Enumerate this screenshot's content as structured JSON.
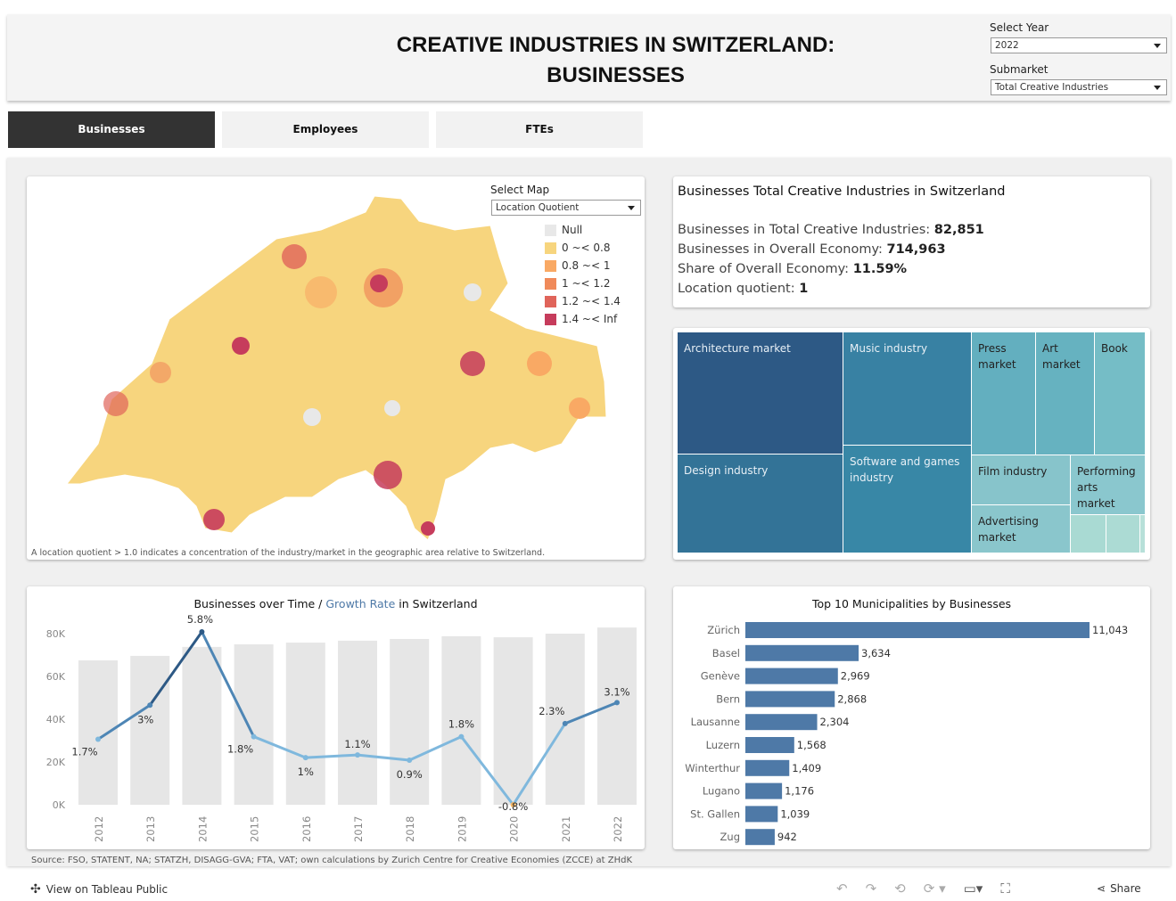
{
  "header": {
    "title_line1": "CREATIVE INDUSTRIES IN SWITZERLAND:",
    "title_line2": "BUSINESSES",
    "year_label": "Select Year",
    "year_value": "2022",
    "submarket_label": "Submarket",
    "submarket_value": "Total Creative Industries"
  },
  "tabs": [
    {
      "label": "Businesses",
      "active": true
    },
    {
      "label": "Employees"
    },
    {
      "label": "FTEs"
    }
  ],
  "map": {
    "select_label": "Select Map",
    "select_value": "Location Quotient",
    "note": "A location quotient > 1.0 indicates a concentration of the industry/market in the geographic area relative to Switzerland.",
    "legend": [
      {
        "label": "Null",
        "color": "#e8e8e8"
      },
      {
        "label": "0 ~< 0.8",
        "color": "#f7d57e"
      },
      {
        "label": "0.8 ~< 1",
        "color": "#f9a964"
      },
      {
        "label": "1 ~< 1.2",
        "color": "#f08a5a"
      },
      {
        "label": "1.2 ~< 1.4",
        "color": "#e0645a"
      },
      {
        "label": "1.4 ~< Inf",
        "color": "#c63c5c"
      }
    ]
  },
  "kpi": {
    "title": "Businesses Total Creative Industries in Switzerland",
    "rows": [
      {
        "label": "Businesses in Total Creative Industries:",
        "value": "82,851"
      },
      {
        "label": "Businesses in Overall Economy:",
        "value": "714,963"
      },
      {
        "label": "Share of Overall Economy:",
        "value": "11.59%"
      },
      {
        "label": "Location quotient:",
        "value": "1"
      }
    ]
  },
  "treemap": [
    {
      "label": "Architecture market",
      "color": "#2d5985"
    },
    {
      "label": "Design industry",
      "color": "#337397"
    },
    {
      "label": "Music industry",
      "color": "#3881a3"
    },
    {
      "label": "Software and games industry",
      "color": "#3887a6"
    },
    {
      "label": "Press market",
      "color": "#63afbf"
    },
    {
      "label": "Art market",
      "color": "#66b2c0"
    },
    {
      "label": "Book",
      "color": "#75bdc6"
    },
    {
      "label": "Film industry",
      "color": "#87c4cb"
    },
    {
      "label": "Performing arts market",
      "color": "#8ac7ce"
    },
    {
      "label": "Advertising market",
      "color": "#8ac6cc"
    }
  ],
  "chart_data": [
    {
      "type": "bar+line",
      "title_part1": "Businesses over Time / ",
      "title_part2": "Growth Rate",
      "title_part3": " in Switzerland",
      "categories": [
        "2012",
        "2013",
        "2014",
        "2015",
        "2016",
        "2017",
        "2018",
        "2019",
        "2020",
        "2021",
        "2022"
      ],
      "bars": [
        67500,
        69600,
        73800,
        75000,
        75800,
        76700,
        77500,
        78800,
        78300,
        80000,
        82851
      ],
      "growth": [
        1.7,
        3,
        5.8,
        1.8,
        1,
        1.1,
        0.9,
        1.8,
        -0.8,
        2.3,
        3.1
      ],
      "growth_labels": [
        "1.7%",
        "3%",
        "5.8%",
        "1.8%",
        "1%",
        "1.1%",
        "0.9%",
        "1.8%",
        "-0.8%",
        "2.3%",
        "3.1%"
      ],
      "yticks": [
        "0K",
        "20K",
        "40K",
        "60K",
        "80K"
      ],
      "ylim": [
        0,
        80000
      ],
      "bar_color": "#e6e6e6"
    },
    {
      "type": "bar",
      "title": "Top 10 Municipalities by Businesses",
      "categories": [
        "Zürich",
        "Basel",
        "Genève",
        "Bern",
        "Lausanne",
        "Luzern",
        "Winterthur",
        "Lugano",
        "St. Gallen",
        "Zug"
      ],
      "values": [
        11043,
        3634,
        2969,
        2868,
        2304,
        1568,
        1409,
        1176,
        1039,
        942
      ],
      "value_labels": [
        "11,043",
        "3,634",
        "2,969",
        "2,868",
        "2,304",
        "1,568",
        "1,409",
        "1,176",
        "1,039",
        "942"
      ],
      "color": "#4e79a7"
    }
  ],
  "source": "Source: FSO, STATENT, NA; STATZH, DISAGG-GVA; FTA, VAT; own calculations by Zurich Centre for Creative Economies (ZCCE) at ZHdK",
  "footer": {
    "view_label": "View on Tableau Public",
    "share_label": "Share"
  }
}
